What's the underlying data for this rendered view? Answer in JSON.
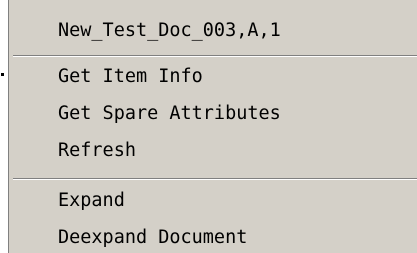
{
  "context_menu": {
    "header": "New_Test_Doc_003,A,1",
    "groups": [
      {
        "items": [
          {
            "label": "Get Item Info"
          },
          {
            "label": "Get Spare Attributes"
          },
          {
            "label": "Refresh"
          }
        ]
      },
      {
        "items": [
          {
            "label": "Expand"
          },
          {
            "label": "Deexpand Document"
          }
        ]
      }
    ]
  }
}
